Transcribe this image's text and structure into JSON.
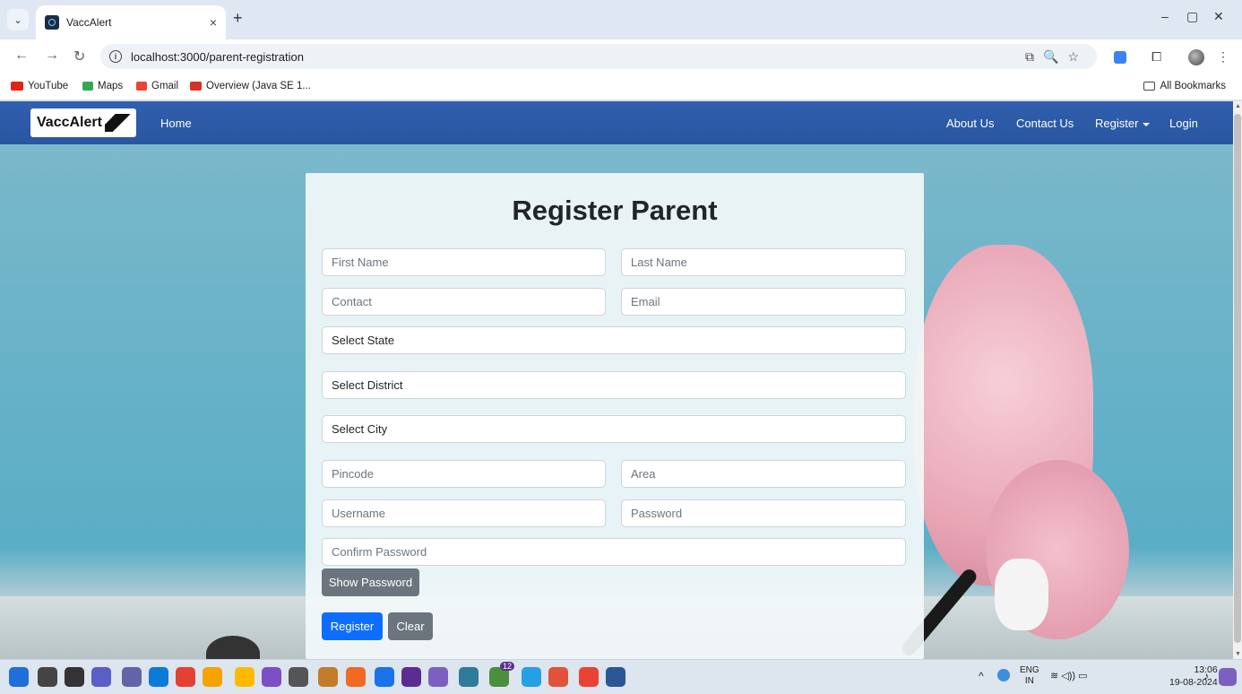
{
  "browser": {
    "tab_title": "VaccAlert",
    "tab_close": "×",
    "new_tab": "+",
    "url": "localhost:3000/parent-registration",
    "window_controls": {
      "minimize": "–",
      "maximize": "▢",
      "close": "✕"
    },
    "bookmarks": [
      {
        "label": "YouTube",
        "color": "#e62117"
      },
      {
        "label": "Maps",
        "color": "#34a853"
      },
      {
        "label": "Gmail",
        "color": "#ea4335"
      },
      {
        "label": "Overview (Java SE 1...",
        "color": "#d93025"
      }
    ],
    "all_bookmarks": "All Bookmarks"
  },
  "navbar": {
    "brand": "VaccAlert",
    "home": "Home",
    "about": "About Us",
    "contact": "Contact Us",
    "register": "Register",
    "login": "Login"
  },
  "form": {
    "title": "Register Parent",
    "first_name_placeholder": "First Name",
    "last_name_placeholder": "Last Name",
    "contact_placeholder": "Contact",
    "email_placeholder": "Email",
    "state_select": "Select State",
    "district_select": "Select District",
    "city_select": "Select City",
    "pincode_placeholder": "Pincode",
    "area_placeholder": "Area",
    "username_placeholder": "Username",
    "password_placeholder": "Password",
    "confirm_password_placeholder": "Confirm Password",
    "show_password": "Show Password",
    "register": "Register",
    "clear": "Clear"
  },
  "taskbar": {
    "language": "ENG",
    "region": "IN",
    "time": "13:06",
    "date": "19-08-2024",
    "badge_count": "12",
    "app_colors": [
      "#1e6fd9",
      "#444",
      "#333",
      "#5a5fc7",
      "#6264a7",
      "#0c7bd8",
      "#e34133",
      "#f4a300",
      "#ffb900",
      "#7d4fc5",
      "#555",
      "#c27c2c",
      "#f06a24",
      "#1a73e8",
      "#5c2d91",
      "#7b60c0",
      "#2d7d9a",
      "#4a8f3c",
      "#25a0e5",
      "#e0533a",
      "#ea4335",
      "#2b5797"
    ]
  },
  "colors": {
    "navbar": "#2f5fae",
    "primary_button": "#0d6efd",
    "secondary_button": "#6c757d"
  }
}
